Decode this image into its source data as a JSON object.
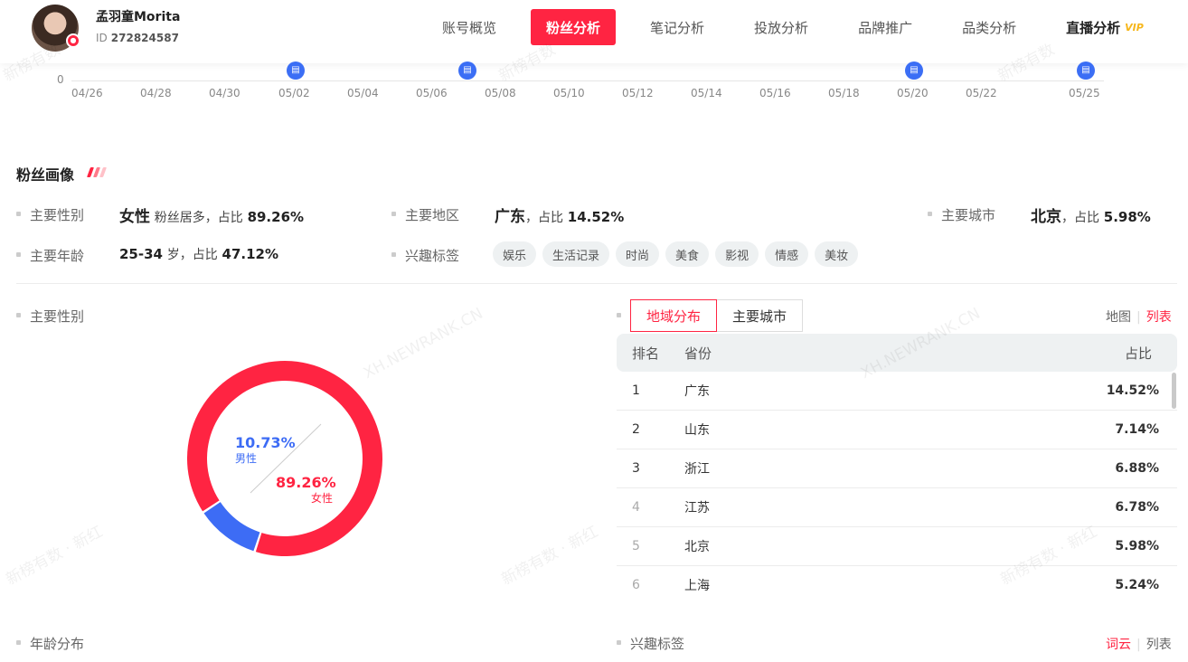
{
  "user": {
    "name": "孟羽童Morita",
    "id_label": "ID",
    "id_value": "272824587"
  },
  "nav": {
    "items": [
      "账号概览",
      "粉丝分析",
      "笔记分析",
      "投放分析",
      "品牌推广",
      "品类分析",
      "直播分析"
    ],
    "active": "粉丝分析",
    "vip_label": "VIP"
  },
  "timeline": {
    "zero_label": "0",
    "ticks": [
      "04/26",
      "04/28",
      "04/30",
      "05/02",
      "05/04",
      "05/06",
      "05/08",
      "05/10",
      "05/12",
      "05/14",
      "05/16",
      "05/18",
      "05/20",
      "05/22",
      "05/25"
    ],
    "note_pins": [
      "05/02",
      "05/07",
      "05/20",
      "05/25"
    ],
    "pin_icon": "book-icon"
  },
  "portrait": {
    "title": "粉丝画像",
    "deco_colors": [
      "#ff2442",
      "#ff7a8a",
      "#ffc1c8"
    ],
    "gender": {
      "label": "主要性别",
      "value": "女性",
      "suffix": "粉丝居多，",
      "ratio_label": "占比",
      "ratio": "89.26%"
    },
    "region": {
      "label": "主要地区",
      "value": "广东",
      "sep": "，",
      "ratio_label": "占比",
      "ratio": "14.52%"
    },
    "city": {
      "label": "主要城市",
      "value": "北京",
      "sep": "，",
      "ratio_label": "占比",
      "ratio": "5.98%"
    },
    "age": {
      "label": "主要年龄",
      "value": "25-34",
      "unit": "岁，",
      "ratio_label": "占比",
      "ratio": "47.12%"
    },
    "interests": {
      "label": "兴趣标签",
      "tags": [
        "娱乐",
        "生活记录",
        "时尚",
        "美食",
        "影视",
        "情感",
        "美妆"
      ]
    }
  },
  "gender_chart": {
    "label": "主要性别",
    "male": {
      "pct": "10.73%",
      "label": "男性",
      "value": 10.73,
      "color": "#3d6cf5"
    },
    "female": {
      "pct": "89.26%",
      "label": "女性",
      "value": 89.26,
      "color": "#ff2442"
    }
  },
  "region_panel": {
    "tabs": [
      "地域分布",
      "主要城市"
    ],
    "active_tab": "地域分布",
    "view_options": [
      "地图",
      "列表"
    ],
    "active_view": "列表",
    "columns": [
      "排名",
      "省份",
      "占比"
    ],
    "rows": [
      {
        "rank": "1",
        "name": "广东",
        "pct": "14.52%"
      },
      {
        "rank": "2",
        "name": "山东",
        "pct": "7.14%"
      },
      {
        "rank": "3",
        "name": "浙江",
        "pct": "6.88%"
      },
      {
        "rank": "4",
        "name": "江苏",
        "pct": "6.78%"
      },
      {
        "rank": "5",
        "name": "北京",
        "pct": "5.98%"
      },
      {
        "rank": "6",
        "name": "上海",
        "pct": "5.24%"
      }
    ]
  },
  "bottom": {
    "age_label": "年龄分布",
    "interest_label": "兴趣标签",
    "view_options": [
      "词云",
      "列表"
    ],
    "active_view": "词云"
  },
  "watermarks": [
    "新榜有数",
    "新榜有数",
    "新榜有数",
    "XH.NEWRANK.CN",
    "XH.NEWRANK.CN",
    "新榜有数 · 新红",
    "新榜有数 · 新红",
    "新榜有数 · 新红"
  ]
}
